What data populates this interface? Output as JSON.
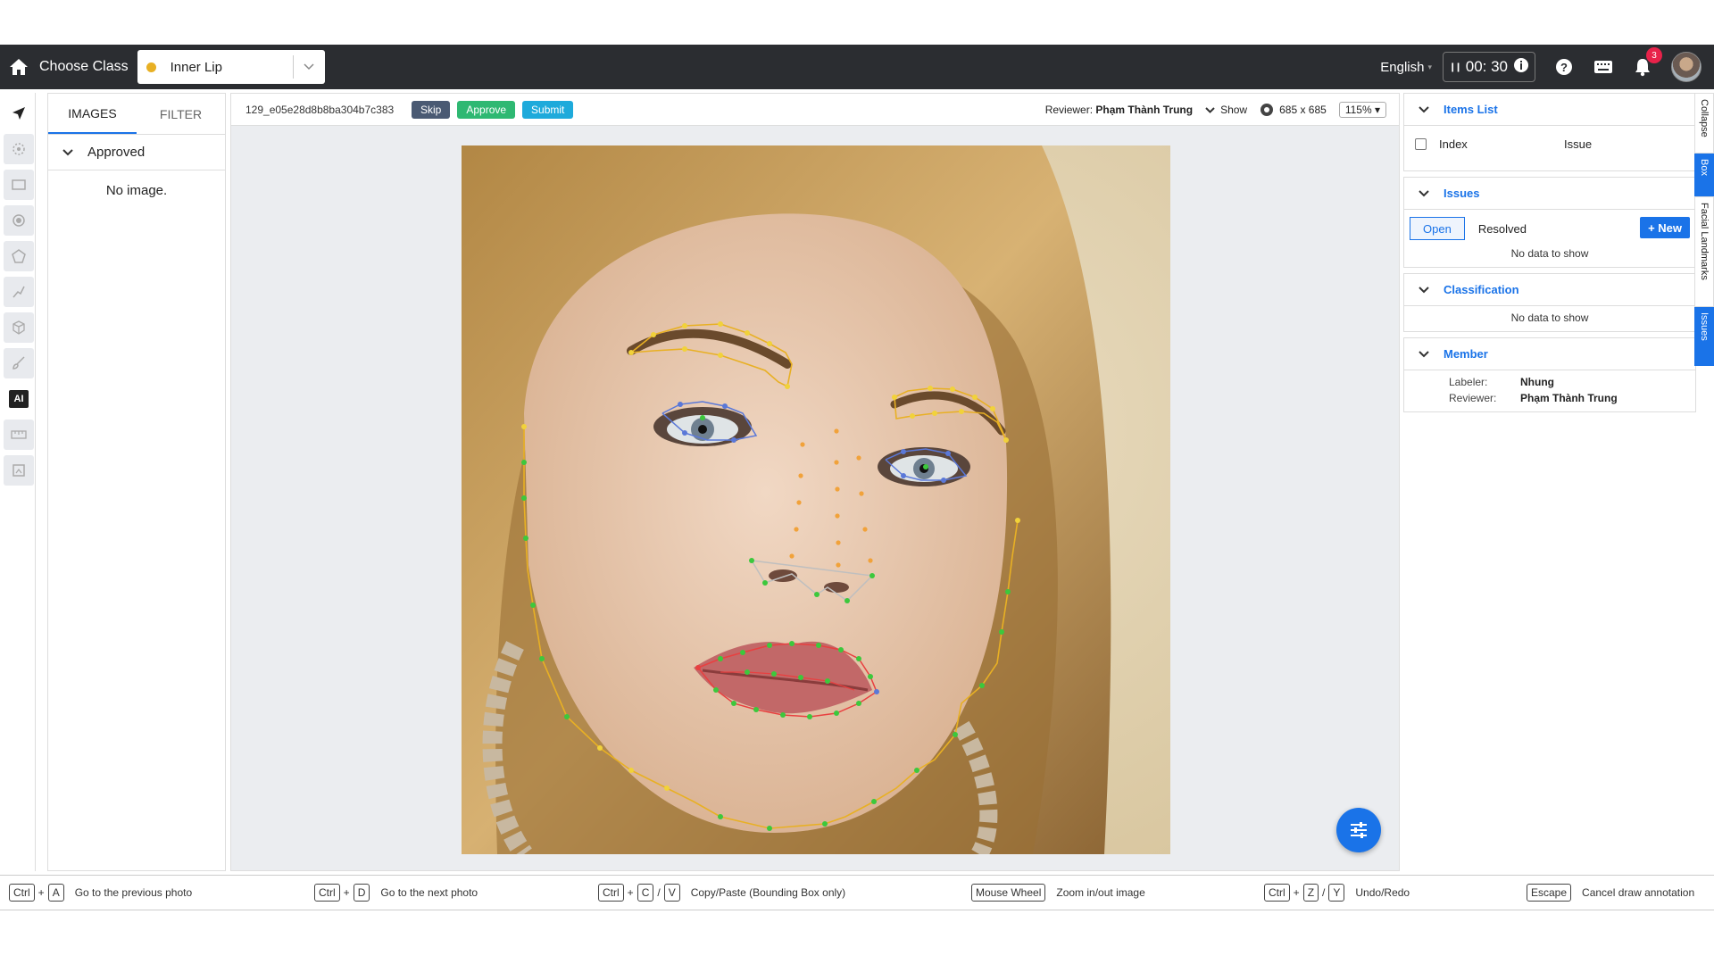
{
  "topbar": {
    "choose_class_label": "Choose Class",
    "class_value": "Inner Lip",
    "class_color": "#e8b024",
    "language": "English",
    "timer": "00: 30",
    "notification_count": "3"
  },
  "tools": [
    "select-arrow-icon",
    "keypoint-icon",
    "rectangle-icon",
    "point-icon",
    "polygon-icon",
    "polyline-icon",
    "cuboid-icon",
    "brush-icon",
    "ai-icon",
    "ruler-icon",
    "frame-icon"
  ],
  "ai_tool_label": "AI",
  "images_panel": {
    "tab_images": "IMAGES",
    "tab_filter": "FILTER",
    "group_label": "Approved",
    "empty_text": "No image."
  },
  "main": {
    "file_name": "129_e05e28d8b8ba304b7c38319...",
    "skip_label": "Skip",
    "approve_label": "Approve",
    "submit_label": "Submit",
    "reviewer_label": "Reviewer:",
    "reviewer_name": "Phạm Thành Trung",
    "show_label": "Show",
    "image_size": "685 x 685",
    "zoom": "115%"
  },
  "right_panel": {
    "items_list_title": "Items List",
    "col_index": "Index",
    "col_issue": "Issue",
    "issues_title": "Issues",
    "issues_tab_open": "Open",
    "issues_tab_resolved": "Resolved",
    "new_button": "+ New",
    "issues_empty": "No data to show",
    "classification_title": "Classification",
    "classification_empty": "No data to show",
    "member_title": "Member",
    "labeler_key": "Labeler:",
    "labeler_value": "Nhung",
    "reviewer_key": "Reviewer:",
    "reviewer_value": "Phạm Thành Trung"
  },
  "side_tabs": {
    "collapse": "Collapse",
    "box": "Box",
    "landmarks": "Facial Landmarks",
    "issues": "Issues"
  },
  "shortcuts": [
    {
      "keys": [
        "Ctrl",
        "A"
      ],
      "seps": [
        "+"
      ],
      "desc": "Go to the previous photo"
    },
    {
      "keys": [
        "Ctrl",
        "D"
      ],
      "seps": [
        "+"
      ],
      "desc": "Go to the next photo"
    },
    {
      "keys": [
        "Ctrl",
        "C",
        "V"
      ],
      "seps": [
        "+",
        "/"
      ],
      "desc": "Copy/Paste (Bounding Box only)"
    },
    {
      "keys": [
        "Mouse Wheel"
      ],
      "seps": [],
      "desc": "Zoom in/out image"
    },
    {
      "keys": [
        "Ctrl",
        "Z",
        "Y"
      ],
      "seps": [
        "+",
        "/"
      ],
      "desc": "Undo/Redo"
    },
    {
      "keys": [
        "Escape"
      ],
      "seps": [],
      "desc": "Cancel draw annotation"
    }
  ]
}
